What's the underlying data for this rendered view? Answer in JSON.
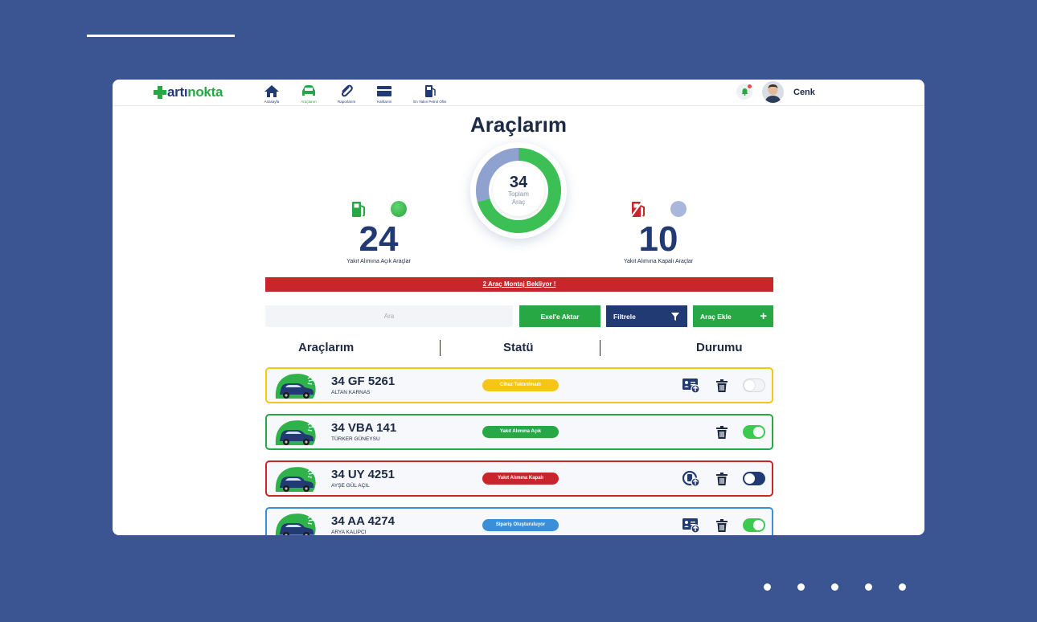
{
  "brand": {
    "logo_part1": "artı",
    "logo_part2": "nokta"
  },
  "nav": {
    "items": [
      {
        "label": "Anasayfa",
        "icon": "home-icon"
      },
      {
        "label": "Araçlarım",
        "icon": "car-icon"
      },
      {
        "label": "Raporlarım",
        "icon": "paperclip-icon"
      },
      {
        "label": "Kartlarım",
        "icon": "card-icon"
      },
      {
        "label": "En Yakın Petrol Ofisi",
        "icon": "fuel-station-icon"
      }
    ],
    "active_index": 1
  },
  "user": {
    "name": "Cenk"
  },
  "page": {
    "title": "Araçlarım"
  },
  "summary": {
    "total": "34",
    "total_label_1": "Toplam",
    "total_label_2": "Araç",
    "open_count": "24",
    "open_label": "Yakıt Alımına Açık Araçlar",
    "closed_count": "10",
    "closed_label": "Yakıt Alımına Kapalı Araçlar",
    "open_fraction": 0.706
  },
  "alert": {
    "text": "2 Araç Montaj Bekliyor !"
  },
  "toolbar": {
    "search_placeholder": "Ara",
    "export_label": "Exel'e Aktar",
    "filter_label": "Filtrele",
    "add_label": "Araç Ekle",
    "add_symbol": "+"
  },
  "table": {
    "headers": [
      "Araçlarım",
      "Statü",
      "Durumu"
    ],
    "rows": [
      {
        "plate": "34 GF 5261",
        "owner": "ALTAN KARNAS",
        "status": "Cihaz Taktırılmadı",
        "status_color": "#f5c518",
        "border_color": "#f5c518",
        "action_icon": "id-card-upload-icon",
        "toggle": "off"
      },
      {
        "plate": "34 VBA 141",
        "owner": "TÜRKER GÜNEYSU",
        "status": "Yakıt Alımına Açık",
        "status_color": "#28a745",
        "border_color": "#28a745",
        "action_icon": "",
        "toggle": "on"
      },
      {
        "plate": "34 UY 4251",
        "owner": "AYŞE GÜL AÇIL",
        "status": "Yakıt Alımına Kapalı",
        "status_color": "#c9262b",
        "border_color": "#c9262b",
        "action_icon": "gas-upload-icon",
        "toggle": "off-dark"
      },
      {
        "plate": "34 AA 4274",
        "owner": "ARYA KALIPCI",
        "status": "Sipariş Oluşturuluyor",
        "status_color": "#3a8fd8",
        "border_color": "#3a8fd8",
        "action_icon": "id-card-upload-icon",
        "toggle": "on"
      }
    ]
  },
  "colors": {
    "brand_blue": "#213a74",
    "brand_green": "#28a745",
    "alert_red": "#c9262b",
    "background": "#3a5592"
  }
}
